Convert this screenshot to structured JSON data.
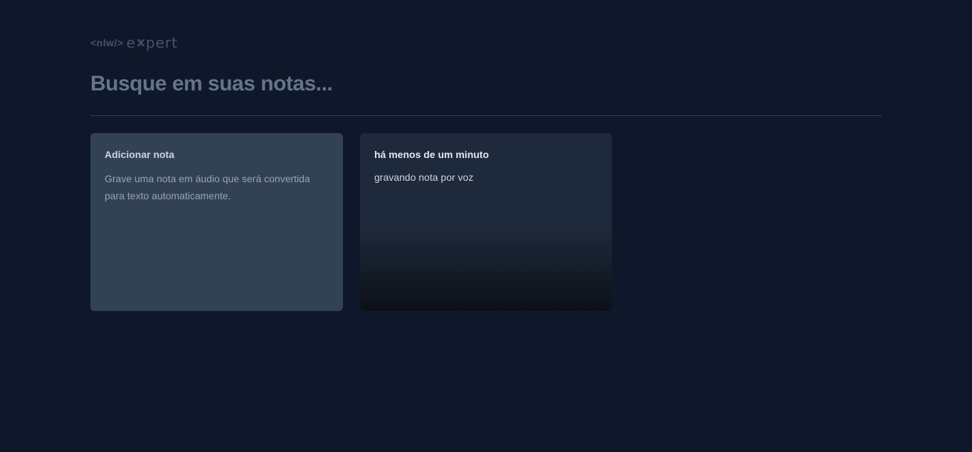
{
  "logo": {
    "code": "<nlw/>",
    "word_left": "e",
    "word_right": "pert"
  },
  "search": {
    "placeholder": "Busque em suas notas...",
    "value": ""
  },
  "add_card": {
    "title": "Adicionar nota",
    "description": "Grave uma nota em áudio que será convertida para texto automaticamente."
  },
  "notes": [
    {
      "date": "há menos de um minuto",
      "content": "gravando nota por voz"
    }
  ],
  "colors": {
    "background": "#0f172a",
    "add_card": "#334155",
    "note_card": "#1e293b",
    "divider": "#334155"
  }
}
